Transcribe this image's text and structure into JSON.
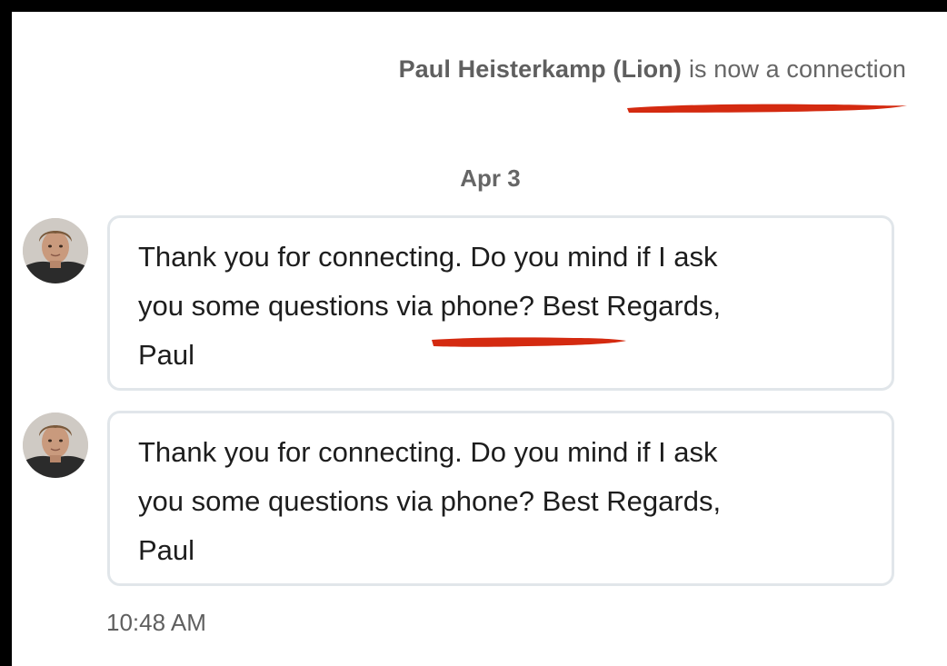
{
  "notice": {
    "name": "Paul Heisterkamp (Lion)",
    "text": "is now a connection"
  },
  "date_divider": "Apr 3",
  "messages": [
    {
      "line1": "Thank you for connecting. Do you mind if I ask",
      "line2_before": "you some questions ",
      "line2_highlight": "via phone",
      "line2_after": "? Best Regards,",
      "line3": "Paul"
    },
    {
      "line1": "Thank you for connecting. Do you mind if I ask",
      "line2": "you some questions via phone? Best Regards,",
      "line3": "Paul"
    }
  ],
  "timestamp": "10:48 AM",
  "colors": {
    "annotation": "#d42a10",
    "bubble_border": "#e1e6ea",
    "text": "#1d1d1d",
    "muted_text": "#666666"
  }
}
